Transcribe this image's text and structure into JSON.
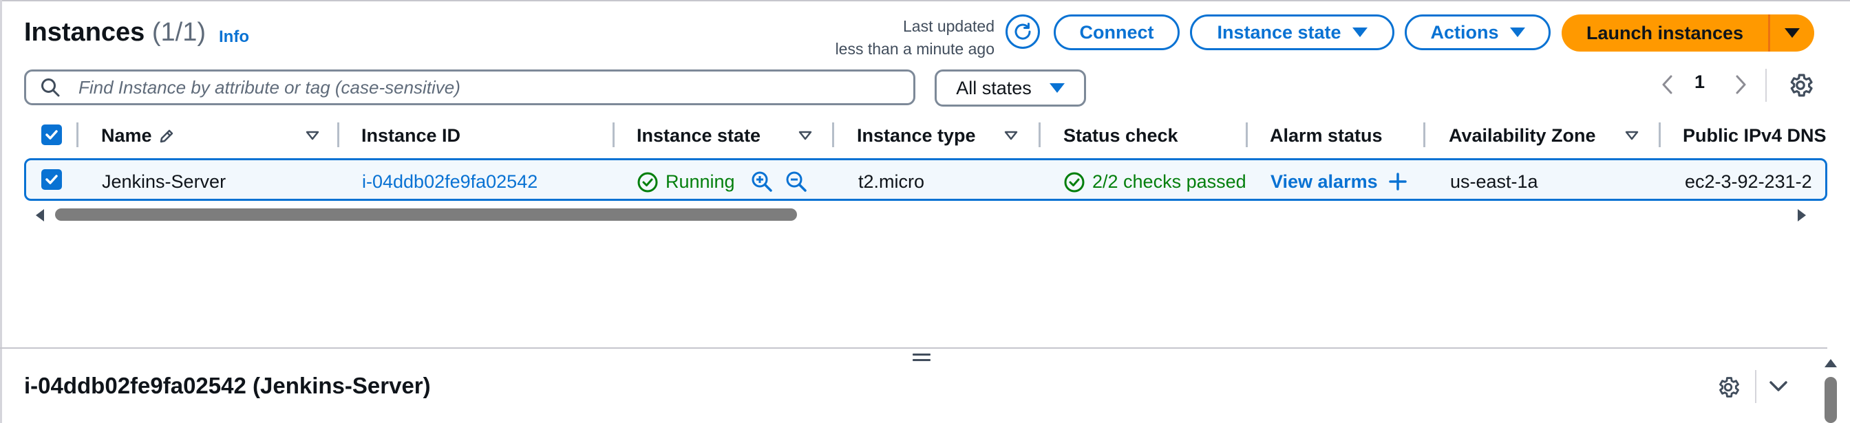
{
  "header": {
    "title": "Instances",
    "count": "(1/1)",
    "info_label": "Info",
    "last_updated_line1": "Last updated",
    "last_updated_line2": "less than a minute ago"
  },
  "toolbar": {
    "connect_label": "Connect",
    "instance_state_label": "Instance state",
    "actions_label": "Actions",
    "launch_label": "Launch instances"
  },
  "search": {
    "placeholder": "Find Instance by attribute or tag (case-sensitive)"
  },
  "filter": {
    "states_label": "All states"
  },
  "pagination": {
    "current_page": "1"
  },
  "table": {
    "columns": [
      "Name",
      "Instance ID",
      "Instance state",
      "Instance type",
      "Status check",
      "Alarm status",
      "Availability Zone",
      "Public IPv4 DNS"
    ],
    "row": {
      "name": "Jenkins-Server",
      "instance_id": "i-04ddb02fe9fa02542",
      "instance_state": "Running",
      "instance_type": "t2.micro",
      "status_check": "2/2 checks passed",
      "alarm_status": "View alarms",
      "availability_zone": "us-east-1a",
      "public_dns": "ec2-3-92-231-2"
    }
  },
  "details": {
    "title": "i-04ddb02fe9fa02542 (Jenkins-Server)"
  },
  "colors": {
    "link_blue": "#0972d3",
    "launch_orange": "#ff9900",
    "success_green": "#037f0c"
  },
  "icons": {
    "refresh": "refresh-icon",
    "search": "search-icon",
    "settings": "gear-icon",
    "edit": "pencil-icon",
    "zoom_in": "zoom-in-icon",
    "zoom_out": "zoom-out-icon",
    "status_ok": "check-circle-icon",
    "add": "plus-icon",
    "collapse": "chevron-down-icon"
  }
}
